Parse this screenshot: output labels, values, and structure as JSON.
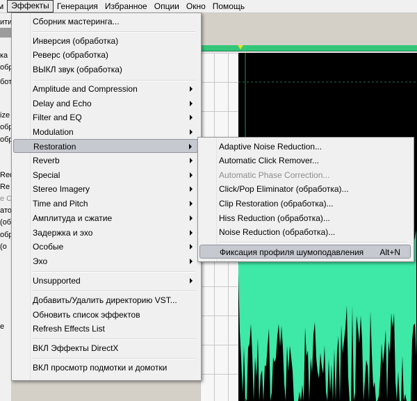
{
  "menubar": {
    "items": [
      "м",
      "Эффекты",
      "Генерация",
      "Избранное",
      "Опции",
      "Окно",
      "Помощь"
    ],
    "active_index": 1
  },
  "left_panel": {
    "fragments": [
      "ити",
      "ка",
      "обра",
      "бот",
      "ize",
      "обра",
      "обр",
      "Red",
      "Re",
      "e C",
      "ато",
      "(об",
      "обр",
      "(о",
      "e"
    ]
  },
  "effects_menu": {
    "items": [
      "Сборник мастеринга...",
      "Инверсия (обработка)",
      "Реверс (обработка)",
      "ВЫКЛ звук (обработка)",
      "Amplitude and Compression",
      "Delay and Echo",
      "Filter and EQ",
      "Modulation",
      "Restoration",
      "Reverb",
      "Special",
      "Stereo Imagery",
      "Time and Pitch",
      "Амплитуда и сжатие",
      "Задержка и эхо",
      "Особые",
      "Эхо",
      "Unsupported",
      "Добавить/Удалить директорию VST...",
      "Обновить список эффектов",
      "Refresh Effects List",
      "ВКЛ Эффекты DirectX",
      "ВКЛ просмотр подмотки и домотки"
    ]
  },
  "restoration_submenu": {
    "items": [
      "Adaptive Noise Reduction...",
      "Automatic Click Remover...",
      "Automatic Phase Correction...",
      "Click/Pop Eliminator (обработка)...",
      "Clip Restoration (обработка)...",
      "Hiss Reduction (обработка)...",
      "Noise Reduction (обработка)...",
      "Фиксация профиля шумоподавления"
    ],
    "shortcut": "Alt+N"
  },
  "colors": {
    "waveform": "#3ee8a6",
    "waveform_bg": "#000000",
    "timeline_ruler": "#34c77a",
    "menu_highlight": "#c6c9d0"
  },
  "icons": {
    "submenu_arrow": "submenu-arrow-icon",
    "ruler_marker": "playhead-marker-icon"
  }
}
